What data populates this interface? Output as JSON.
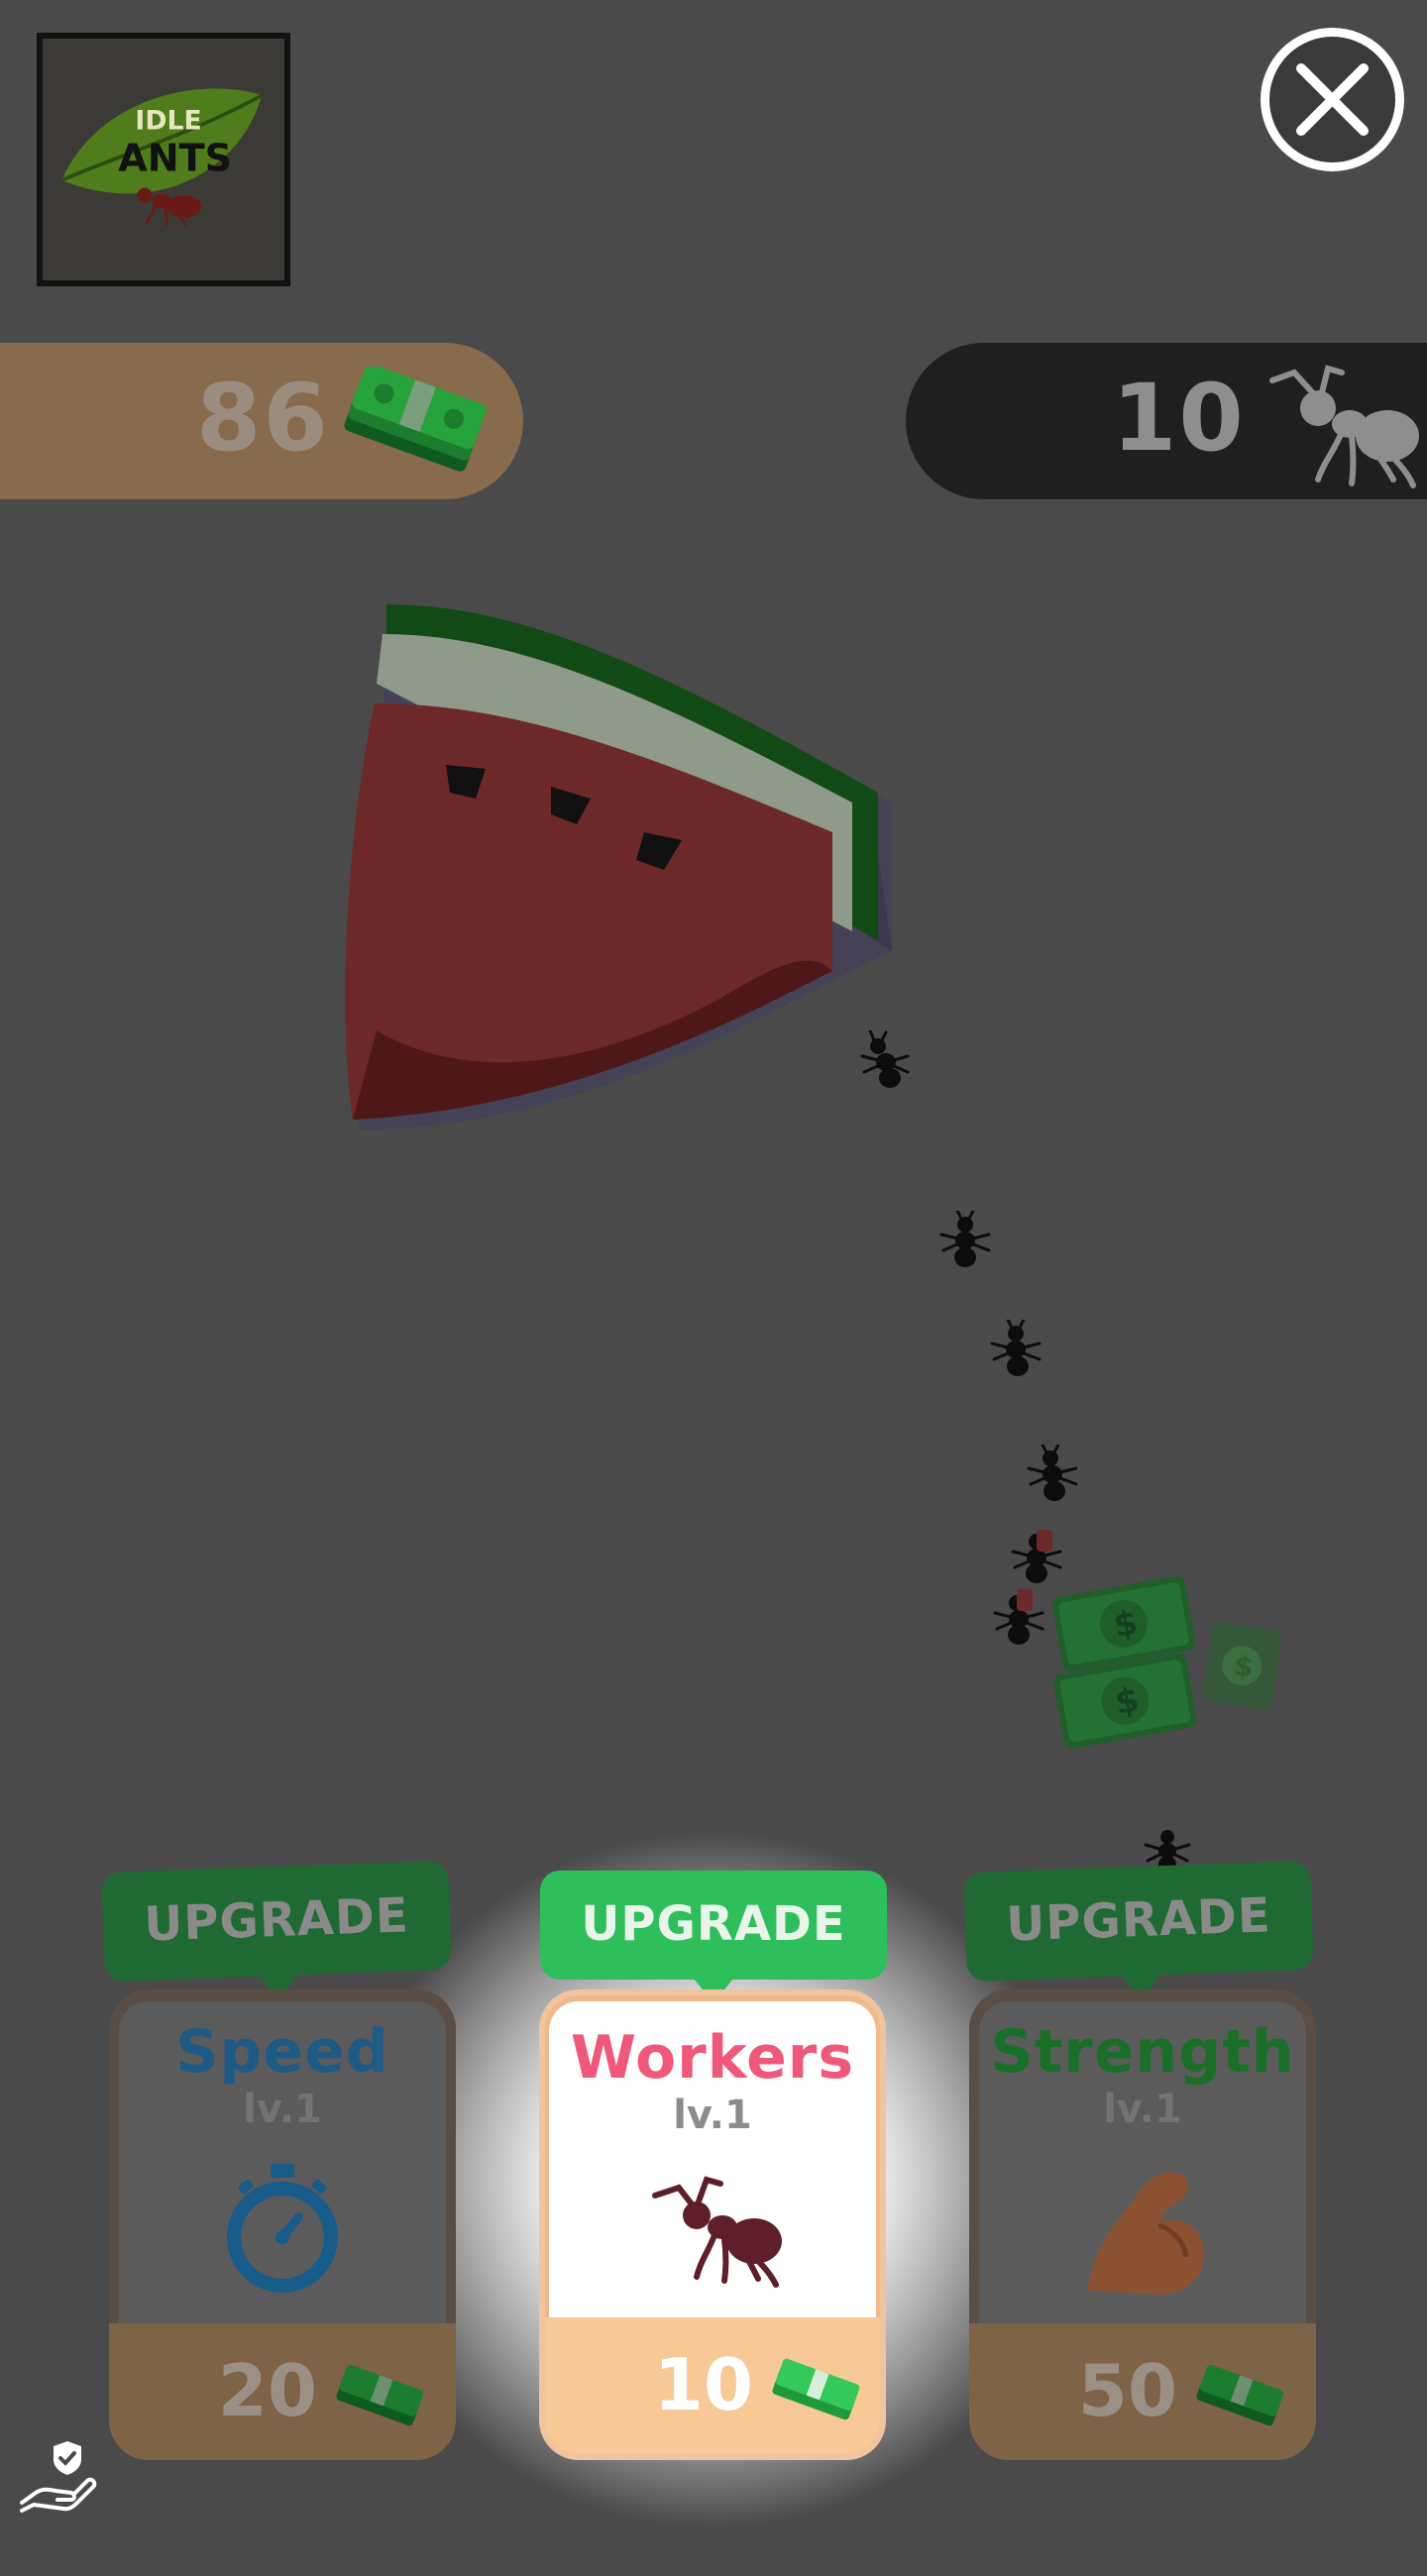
{
  "logo": {
    "line1": "IDLE",
    "line2": "ANTS"
  },
  "close_button": {
    "icon": "close-icon"
  },
  "hud": {
    "money": {
      "value": "86",
      "icon": "cash-stack-icon",
      "color": "#876b4c"
    },
    "workers": {
      "value": "10",
      "icon": "ant-icon",
      "color": "#1f1f1f"
    }
  },
  "upgrades": [
    {
      "banner": "UPGRADE",
      "title": "Speed",
      "level": "lv.1",
      "icon": "stopwatch-icon",
      "cost": "20",
      "title_color": "#1e6b9a",
      "highlighted": false
    },
    {
      "banner": "UPGRADE",
      "title": "Workers",
      "level": "lv.1",
      "icon": "ant-icon",
      "cost": "10",
      "title_color": "#f0587a",
      "highlighted": true
    },
    {
      "banner": "UPGRADE",
      "title": "Strength",
      "level": "lv.1",
      "icon": "flexed-arm-icon",
      "cost": "50",
      "title_color": "#1a7a2c",
      "highlighted": false
    }
  ],
  "privacy": {
    "icon": "privacy-hand-shield-icon"
  },
  "colors": {
    "dim_overlay": "#4a4a4a",
    "accent_green": "#2fbe5c",
    "accent_pink": "#f0587a"
  }
}
